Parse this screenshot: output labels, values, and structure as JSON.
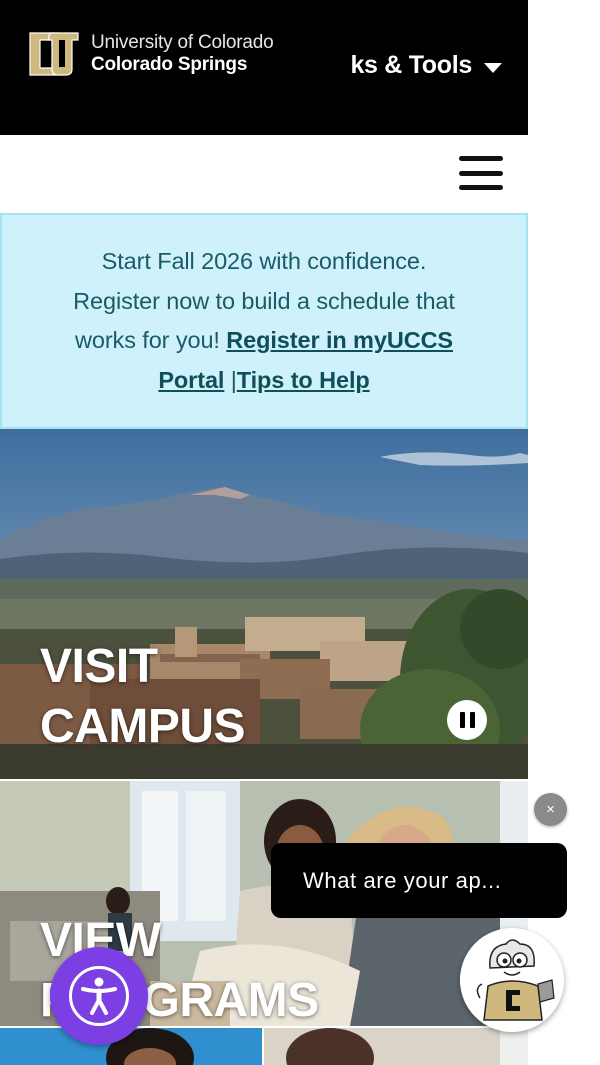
{
  "header": {
    "logo_line1": "University of Colorado",
    "logo_line2": "Colorado Springs",
    "links_tools_label": "ks & Tools",
    "logo_icon": "cu-logo-icon",
    "caret_icon": "caret-down-icon",
    "menu_icon": "hamburger-menu-icon"
  },
  "alert": {
    "text": "Start Fall 2026 with confidence. Register now to build a schedule that works for you! ",
    "link_register": "Register in myUCCS Portal",
    "separator": " |",
    "link_tips": "Tips to Help"
  },
  "panels": [
    {
      "title": "VISIT CAMPUS"
    },
    {
      "title": "VIEW PROGRAMS"
    }
  ],
  "slideshow": {
    "pause_icon": "pause-icon"
  },
  "chat": {
    "close_label": "×",
    "prompt_text": "What  are your ap...",
    "mascot_icon": "mascot-avatar-icon"
  },
  "accessibility": {
    "icon": "accessibility-icon"
  },
  "colors": {
    "header_bg": "#000000",
    "alert_bg": "#cff1fb",
    "alert_text": "#195c67",
    "cu_gold": "#cfb87c",
    "a11y_purple": "#7b3fe4"
  }
}
